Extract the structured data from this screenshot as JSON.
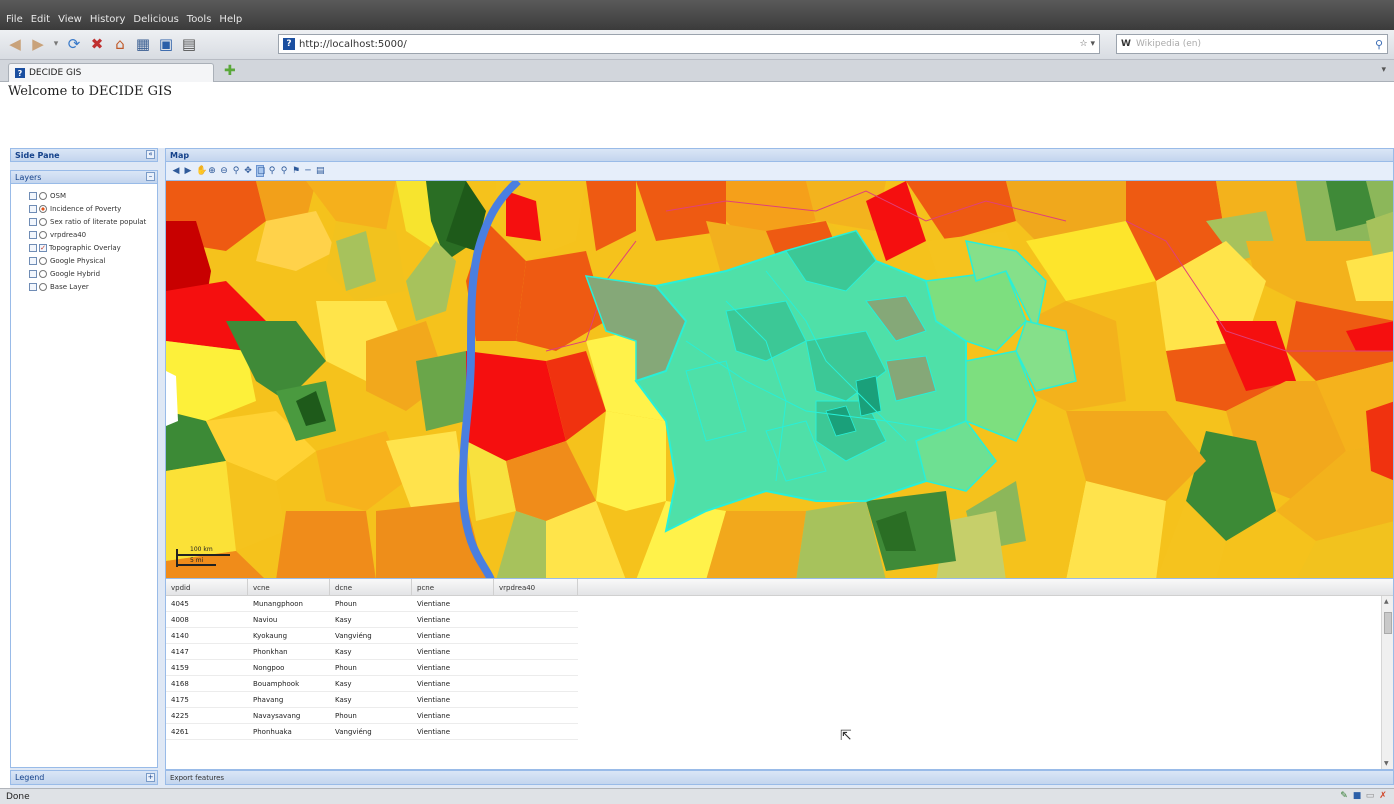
{
  "browser": {
    "menu": [
      "File",
      "Edit",
      "View",
      "History",
      "Delicious",
      "Tools",
      "Help"
    ],
    "url": "http://localhost:5000/",
    "search_placeholder": "Wikipedia (en)",
    "search_engine": "W",
    "tab_title": "DECIDE GIS",
    "status": "Done"
  },
  "page": {
    "welcome": "Welcome to DECIDE GIS"
  },
  "side_pane": {
    "title": "Side Pane",
    "layers_title": "Layers",
    "layers": [
      {
        "label": "OSM",
        "checked": false,
        "active": false
      },
      {
        "label": "Incidence of Poverty",
        "checked": false,
        "active": true
      },
      {
        "label": "Sex ratio of literate populat",
        "checked": false,
        "active": false
      },
      {
        "label": "vrpdrea40",
        "checked": false,
        "active": false
      },
      {
        "label": "Topographic Overlay",
        "checked": true,
        "active": false
      },
      {
        "label": "Google Physical",
        "checked": false,
        "active": false
      },
      {
        "label": "Google Hybrid",
        "checked": false,
        "active": false
      },
      {
        "label": "Base Layer",
        "checked": false,
        "active": false
      }
    ],
    "legend_title": "Legend"
  },
  "map": {
    "title": "Map",
    "tools": [
      "back-icon",
      "forward-icon",
      "pan-icon",
      "zoom-in-icon",
      "zoom-out-icon",
      "zoom-box-icon",
      "zoom-extent-icon",
      "select-icon",
      "identify-icon",
      "query-icon",
      "tooltip-icon",
      "measure-icon",
      "print-icon"
    ],
    "scale_top": "100 km",
    "scale_bottom": "5 mi",
    "colors": {
      "river": "#4a7fe0",
      "highlight_fill": "#4fe0a8",
      "highlight_stroke": "#28f0d8",
      "boundary": "#e0407a"
    }
  },
  "grid": {
    "columns": [
      "vpdid",
      "vcne",
      "dcne",
      "pcne",
      "vrpdrea40"
    ],
    "rows": [
      [
        "4045",
        "Munangphoon",
        "Phoun",
        "Vientiane",
        ""
      ],
      [
        "4008",
        "Naviou",
        "Kasy",
        "Vientiane",
        ""
      ],
      [
        "4140",
        "Kyokaung",
        "Vangviéng",
        "Vientiane",
        ""
      ],
      [
        "4147",
        "Phonkhan",
        "Kasy",
        "Vientiane",
        ""
      ],
      [
        "4159",
        "Nongpoo",
        "Phoun",
        "Vientiane",
        ""
      ],
      [
        "4168",
        "Bouamphook",
        "Kasy",
        "Vientiane",
        ""
      ],
      [
        "4175",
        "Phavang",
        "Kasy",
        "Vientiane",
        ""
      ],
      [
        "4225",
        "Navaysavang",
        "Phoun",
        "Vientiane",
        ""
      ],
      [
        "4261",
        "Phonhuaka",
        "Vangviéng",
        "Vientiane",
        ""
      ]
    ],
    "export_label": "Export features"
  }
}
